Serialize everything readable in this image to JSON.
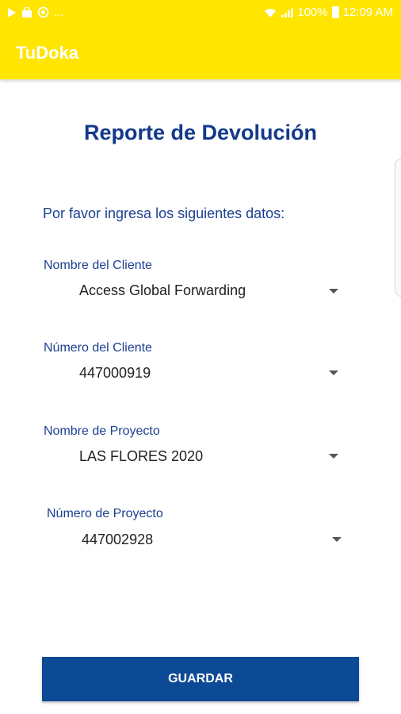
{
  "status_bar": {
    "left_icons": [
      "play-icon",
      "bag-icon",
      "whatsapp-icon"
    ],
    "more": "...",
    "battery": "100%",
    "time": "12:09 AM"
  },
  "app_bar": {
    "title": "TuDoka",
    "color": "#ffe500"
  },
  "page": {
    "title": "Reporte de Devolución",
    "intro": "Por favor ingresa los siguientes datos:"
  },
  "fields": [
    {
      "label": "Nombre del Cliente",
      "value": "Access Global Forwarding"
    },
    {
      "label": "Número del Cliente",
      "value": "447000919"
    },
    {
      "label": "Nombre de Proyecto",
      "value": "LAS FLORES 2020"
    },
    {
      "label": "Número de Proyecto",
      "value": "447002928"
    }
  ],
  "save_button": {
    "label": "GUARDAR",
    "color": "#0d4a96"
  }
}
